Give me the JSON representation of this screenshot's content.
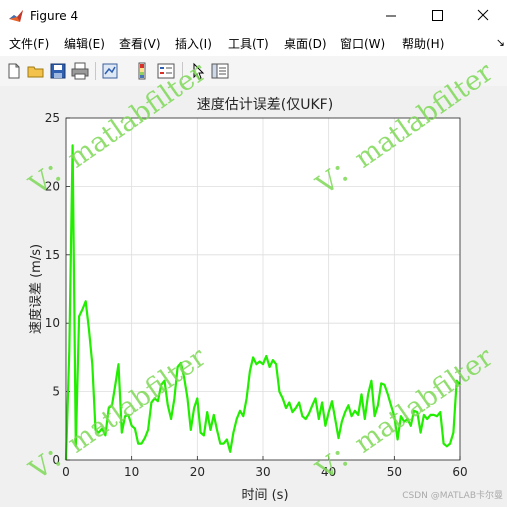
{
  "window": {
    "title": "Figure 4",
    "colors": {
      "titlebar": "#ffffff",
      "figure_bg": "#f0f0f0",
      "line": "#22ee00"
    }
  },
  "menu": {
    "items": [
      "文件(F)",
      "编辑(E)",
      "查看(V)",
      "插入(I)",
      "工具(T)",
      "桌面(D)",
      "窗口(W)",
      "帮助(H)"
    ],
    "overflow_icon": "chevron-right-icon"
  },
  "toolbar": {
    "icons": [
      "new-figure-icon",
      "open-file-icon",
      "save-icon",
      "print-icon",
      "link-plot-icon",
      "colorbar-icon",
      "legend-icon",
      "cursor-icon",
      "property-editor-icon"
    ]
  },
  "watermark": {
    "text": "V：matlabfilter"
  },
  "footer": {
    "credit": "CSDN @MATLAB卡尔曼"
  },
  "chart_data": {
    "type": "line",
    "title": "速度估计误差(仅UKF)",
    "xlabel": "时间 (s)",
    "ylabel": "速度误差 (m/s)",
    "xlim": [
      0,
      60
    ],
    "ylim": [
      0,
      25
    ],
    "xticks": [
      0,
      10,
      20,
      30,
      40,
      50,
      60
    ],
    "yticks": [
      0,
      5,
      10,
      15,
      20,
      25
    ],
    "grid": true,
    "series": [
      {
        "color": "#22ee00",
        "x": [
          0,
          0.5,
          1,
          1.5,
          2,
          2.5,
          3,
          3.5,
          4,
          4.5,
          5,
          5.5,
          6,
          6.5,
          7,
          7.5,
          8,
          8.5,
          9,
          9.5,
          10,
          10.5,
          11,
          11.5,
          12,
          12.5,
          13,
          13.5,
          14,
          14.5,
          15,
          15.5,
          16,
          16.5,
          17,
          17.5,
          18,
          18.5,
          19,
          19.5,
          20,
          20.5,
          21,
          21.5,
          22,
          22.5,
          23,
          23.5,
          24,
          24.5,
          25,
          25.5,
          26,
          26.5,
          27,
          27.5,
          28,
          28.5,
          29,
          29.5,
          30,
          30.5,
          31,
          31.5,
          32,
          32.5,
          33,
          33.5,
          34,
          34.5,
          35,
          35.5,
          36,
          36.5,
          37,
          37.5,
          38,
          38.5,
          39,
          39.5,
          40,
          40.5,
          41,
          41.5,
          42,
          42.5,
          43,
          43.5,
          44,
          44.5,
          45,
          45.5,
          46,
          46.5,
          47,
          47.5,
          48,
          48.5,
          49,
          49.5,
          50,
          50.5,
          51,
          51.5,
          52,
          52.5,
          53,
          53.5,
          54,
          54.5,
          55,
          55.5,
          56,
          56.5,
          57,
          57.5,
          58,
          58.5,
          59,
          59.5,
          60
        ],
        "y": [
          0,
          8,
          23,
          1,
          10.5,
          11,
          11.6,
          9.5,
          7,
          2.2,
          2.0,
          2.3,
          1.8,
          3.8,
          4.0,
          5.5,
          7.0,
          2.0,
          3.2,
          3.3,
          2.5,
          2.3,
          1.2,
          1.2,
          1.6,
          2.2,
          4.2,
          4.5,
          4.3,
          5.5,
          5.8,
          4.0,
          3.0,
          4.5,
          6.8,
          7.1,
          6.0,
          4.5,
          2.2,
          3.8,
          4.5,
          2.0,
          1.8,
          3.5,
          2.2,
          3.3,
          2.2,
          1.2,
          1.2,
          1.5,
          0.6,
          2.0,
          3.0,
          3.6,
          3.2,
          4.5,
          6.5,
          7.5,
          7.0,
          7.2,
          7.0,
          7.6,
          6.8,
          7.3,
          7.0,
          5.0,
          4.5,
          3.8,
          4.2,
          3.5,
          3.8,
          4.2,
          3.2,
          3.0,
          3.4,
          4.0,
          4.5,
          3.0,
          4.2,
          2.5,
          3.5,
          4.3,
          3.0,
          1.6,
          2.8,
          3.5,
          4.0,
          3.2,
          3.6,
          3.3,
          4.8,
          3.0,
          4.8,
          5.8,
          3.2,
          4.0,
          5.6,
          5.5,
          4.8,
          4.0,
          3.2,
          1.5,
          3.2,
          2.8,
          3.0,
          2.5,
          3.6,
          3.5,
          2.0,
          3.3,
          3.0,
          3.3,
          3.3,
          3.2,
          3.5,
          1.2,
          1.0,
          1.2,
          2.0,
          5.8,
          5.5
        ]
      }
    ]
  }
}
